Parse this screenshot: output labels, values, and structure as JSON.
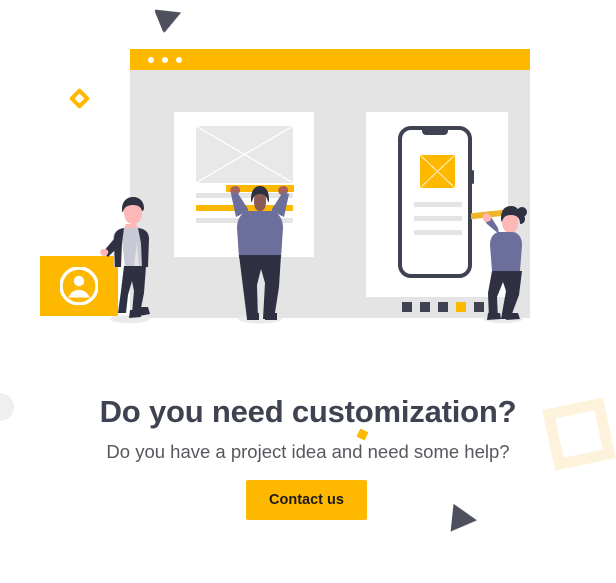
{
  "page": {
    "background_color": "#ffffff"
  },
  "colors": {
    "brand_yellow": "#ffb800",
    "cream": "#fdf3dc",
    "ink": "#3f4250",
    "subtitle_gray": "#57585e",
    "panel_gray": "#e4e4e4",
    "line_gray": "#e8e8e8",
    "shirt_purple": "#6c6f9c",
    "pants_navy": "#2f3142",
    "suit_dark": "#2f3142",
    "skin": "#ffb8b8"
  },
  "illustration": {
    "name": "web-design-team-illustration",
    "browser_mockup": {
      "title_bar_dots": [
        "dot-1",
        "dot-2",
        "dot-3"
      ],
      "left_card": {
        "image_placeholder": "crossed-box-placeholder",
        "text_lines": [
          "line-gray-1",
          "line-yellow-highlight",
          "line-gray-2"
        ]
      },
      "right_card": {
        "device": "smartphone-mockup",
        "image_placeholder": "crossed-box-placeholder-yellow",
        "text_lines": [
          "line-1",
          "line-2",
          "line-3"
        ]
      },
      "pagination_dots": [
        {
          "state": "off"
        },
        {
          "state": "off"
        },
        {
          "state": "off"
        },
        {
          "state": "on"
        },
        {
          "state": "off"
        }
      ]
    },
    "avatar_card": {
      "icon": "user-avatar-icon"
    },
    "figures": [
      {
        "name": "man-leaning-on-card",
        "holding": null
      },
      {
        "name": "man-lifting-yellow-bar",
        "holding": "yellow-bar"
      },
      {
        "name": "woman-with-pencil",
        "holding": "yellow-pencil"
      }
    ],
    "decorations": [
      {
        "name": "dark-triangle-top",
        "shape": "triangle",
        "color": "#3f4250"
      },
      {
        "name": "dark-triangle-bottom",
        "shape": "triangle",
        "color": "#3f4250"
      },
      {
        "name": "cream-square-outline",
        "shape": "square-outline",
        "color": "#fdf3dc"
      },
      {
        "name": "small-yellow-square",
        "shape": "square",
        "color": "#ffb800"
      },
      {
        "name": "gray-circle-edge",
        "shape": "circle",
        "color": "#efefef"
      },
      {
        "name": "yellow-diamond",
        "shape": "diamond",
        "color": "#ffb800"
      }
    ]
  },
  "copy": {
    "headline": "Do you need customization?",
    "subhead": "Do you have a project idea and need some help?"
  },
  "cta": {
    "label": "Contact us"
  }
}
